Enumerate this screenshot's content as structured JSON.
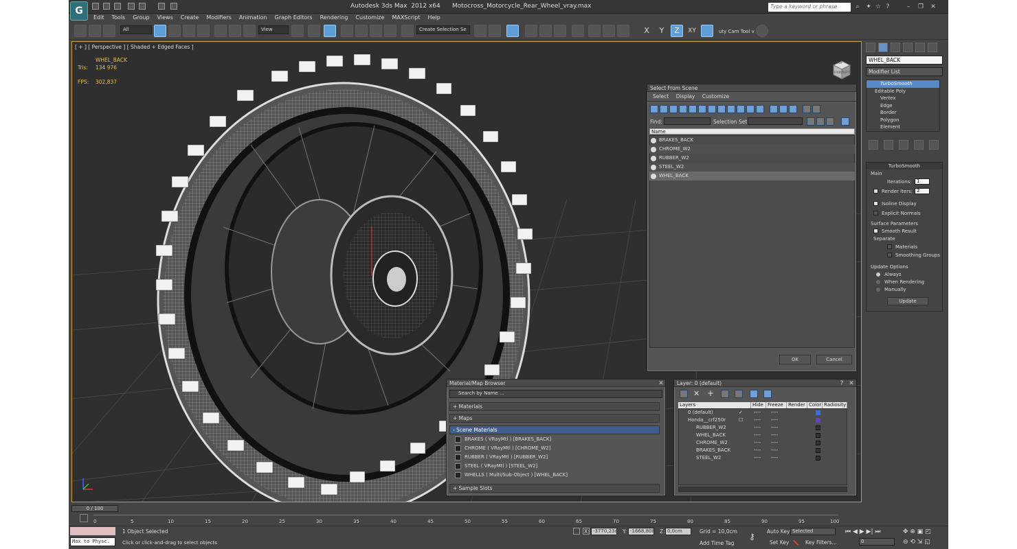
{
  "title": {
    "app": "Autodesk 3ds Max  2012 x64",
    "file": "Motocross_Motorcycle_Rear_Wheel_vray.max",
    "search_placeholder": "Type a keyword or phrase"
  },
  "menu": [
    "Edit",
    "Tools",
    "Group",
    "Views",
    "Create",
    "Modifiers",
    "Animation",
    "Graph Editors",
    "Rendering",
    "Customize",
    "MAXScript",
    "Help"
  ],
  "toolbar": {
    "filter": "All",
    "refcoord": "View",
    "selection_set": "Create Selection Se",
    "axes": [
      "X",
      "Y",
      "Z",
      "XY"
    ],
    "script": "uty Cam Tool v"
  },
  "viewport": {
    "label": "[ + ] [ Perspective ] [ Shaded + Edged Faces ]",
    "object": "WHEL_BACK",
    "tris_label": "Tris:",
    "tris_value": "134 976",
    "fps_label": "FPS:",
    "fps_value": "302,837",
    "cube_top": "TOP",
    "cube_left": "FRONT",
    "cube_right": "LEFT"
  },
  "command_panel": {
    "object_name": "WHEL_BACK",
    "modifier_list": "Modifier List",
    "stack": [
      "TurboSmooth",
      "Editable Poly",
      "Vertex",
      "Edge",
      "Border",
      "Polygon",
      "Element"
    ],
    "turbosmooth": {
      "title": "TurboSmooth",
      "main": "Main",
      "iterations_label": "Iterations:",
      "iterations": "1",
      "render_iters_label": "Render Iters:",
      "render_iters": "2",
      "isoline": "Isoline Display",
      "explicit": "Explicit Normals",
      "surface": "Surface Parameters",
      "smooth_result": "Smooth Result",
      "separate": "Separate",
      "materials": "Materials",
      "smoothing_groups": "Smoothing Groups",
      "update_options": "Update Options",
      "always": "Always",
      "when_rendering": "When Rendering",
      "manually": "Manually",
      "update": "Update"
    }
  },
  "select_from_scene": {
    "title": "Select From Scene",
    "menu": [
      "Select",
      "Display",
      "Customize"
    ],
    "find_label": "Find:",
    "selset_label": "Selection Set:",
    "column": "Name",
    "items": [
      "BRAKES_BACK",
      "CHROME_W2",
      "RUBBER_W2",
      "STEEL_W2",
      "WHEL_BACK"
    ],
    "ok": "OK",
    "cancel": "Cancel"
  },
  "material_browser": {
    "title": "Material/Map Browser",
    "search_placeholder": "Search by Name ...",
    "groups": [
      "+ Materials",
      "+ Maps",
      "- Scene Materials",
      "+ Sample Slots"
    ],
    "materials": [
      "BRAKES  ( VRayMtl )  [BRAKES_BACK]",
      "CHROME  ( VRayMtl )  [CHROME_W2]",
      "RUBBER  ( VRayMtl )  [RUBBER_W2]",
      "STEEL  ( VRayMtl )  [STEEL_W2]",
      "WHELLS  ( Multi/Sub-Object )  [WHEL_BACK]"
    ]
  },
  "layer_dialog": {
    "title": "Layer: 0 (default)",
    "headers": [
      "Layers",
      "Hide",
      "Freeze",
      "Render",
      "Color",
      "Radiosity"
    ],
    "rows": [
      "0 (default)",
      "Honda__crf250r",
      "RUBBER_W2",
      "WHEL_BACK",
      "CHROME_W2",
      "BRAKES_BACK",
      "STEEL_W2"
    ],
    "row_colors": [
      "#3a6fd8",
      "#6a3fd0",
      "#333333",
      "#333333",
      "#333333",
      "#333333",
      "#333333"
    ],
    "marker": "----"
  },
  "timeline": {
    "position": "0 / 100",
    "ticks": [
      "0",
      "5",
      "10",
      "15",
      "20",
      "25",
      "30",
      "35",
      "40",
      "45",
      "50",
      "55",
      "60",
      "65",
      "70",
      "75",
      "80",
      "85",
      "90",
      "95",
      "100"
    ]
  },
  "status": {
    "script_label": "Max to Physc.",
    "selected": "1 Object Selected",
    "prompt": "Click or click-and-drag to select objects",
    "x_label": "X:",
    "x": "-3770,23c",
    "y_label": "Y:",
    "y": "-1668,808",
    "z_label": "Z:",
    "z": "0,0cm",
    "grid": "Grid = 10,0cm",
    "add_time_tag": "Add Time Tag",
    "auto_key": "Auto Key",
    "set_key": "Set Key",
    "key_mode": "Selected",
    "key_filters": "Key Filters...",
    "frame": "0"
  }
}
